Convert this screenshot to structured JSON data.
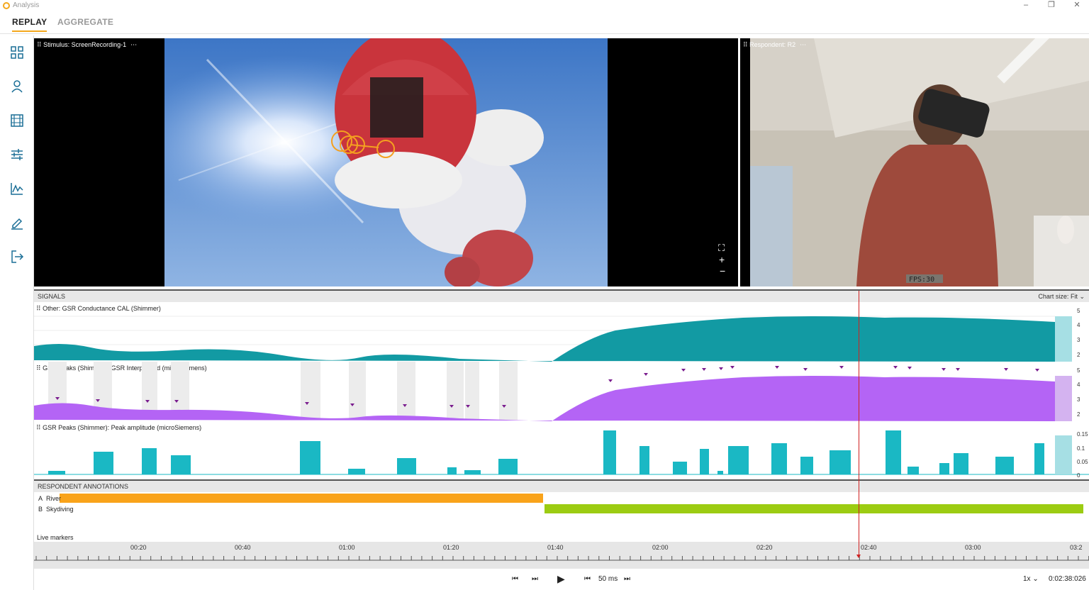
{
  "app": {
    "title": "Analysis"
  },
  "window_controls": [
    "–",
    "❐",
    "✕"
  ],
  "tabs": [
    {
      "label": "REPLAY",
      "active": true
    },
    {
      "label": "AGGREGATE",
      "active": false
    }
  ],
  "sidebar": [
    {
      "icon": "dashboard-icon"
    },
    {
      "icon": "person-icon"
    },
    {
      "icon": "film-icon"
    },
    {
      "icon": "sliders-icon"
    },
    {
      "icon": "chart-icon"
    },
    {
      "icon": "pen-icon"
    },
    {
      "icon": "export-icon"
    }
  ],
  "stimulus_panel": {
    "title": "Stimulus: ScreenRecording-1",
    "menu": "⋯",
    "view_controls": [
      "⛶",
      "+",
      "−"
    ]
  },
  "respondent_panel": {
    "title": "Respondent: R2",
    "menu": "⋯",
    "fps_overlay": "FPS:30"
  },
  "signals": {
    "header": "SIGNALS",
    "chart_size_label": "Chart size:",
    "chart_size_value": "Fit",
    "charts": [
      {
        "label": "Other: GSR Conductance CAL (Shimmer)",
        "ticks": [
          "5",
          "4",
          "3",
          "2"
        ],
        "color": "#1597a0"
      },
      {
        "label": "GSR Peaks (Shimmer): GSR Interpolated (microSiemens)",
        "ticks": [
          "5",
          "4",
          "3",
          "2"
        ],
        "color": "#b86cf0"
      },
      {
        "label": "GSR Peaks (Shimmer): Peak amplitude (microSiemens)",
        "ticks": [
          "0.15",
          "0.1",
          "0.05",
          "0"
        ],
        "color": "#1ab8c4"
      }
    ]
  },
  "annotations": {
    "header": "RESPONDENT ANNOTATIONS",
    "rows": [
      {
        "letter": "A",
        "name": "River",
        "color": "#f9a31a"
      },
      {
        "letter": "B",
        "name": "Skydiving",
        "color": "#9ccc12"
      }
    ],
    "live_markers_label": "Live markers"
  },
  "timeline": {
    "ticks": [
      "00:20",
      "00:40",
      "01:00",
      "01:20",
      "01:40",
      "02:00",
      "02:20",
      "02:40",
      "03:00",
      "03:2"
    ],
    "playhead_time": "02:40"
  },
  "controls": {
    "skip_start": "⏮",
    "skip_end": "⏭",
    "play": "▶",
    "step_back": "⏮",
    "step_value": "50 ms",
    "step_forward": "⏭",
    "speed": "1x",
    "time": "0:02:38:026"
  }
}
